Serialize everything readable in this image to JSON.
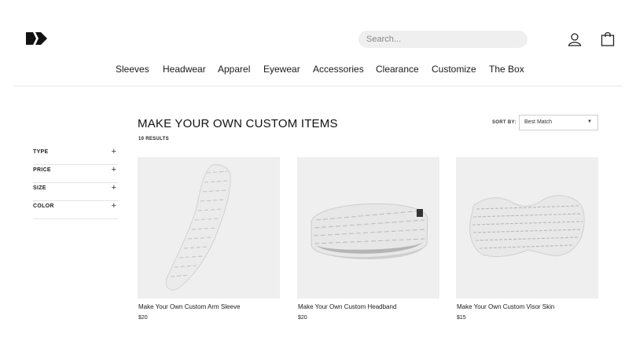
{
  "header": {
    "search_placeholder": "Search...",
    "user_icon": "user-icon",
    "cart_icon": "shopping-bag-icon"
  },
  "nav": {
    "items": [
      {
        "label": "Sleeves"
      },
      {
        "label": "Headwear"
      },
      {
        "label": "Apparel"
      },
      {
        "label": "Eyewear"
      },
      {
        "label": "Accessories"
      },
      {
        "label": "Clearance"
      },
      {
        "label": "Customize"
      },
      {
        "label": "The Box"
      }
    ]
  },
  "filters": [
    {
      "label": "TYPE",
      "toggle": "+"
    },
    {
      "label": "PRICE",
      "toggle": "+"
    },
    {
      "label": "SIZE",
      "toggle": "+"
    },
    {
      "label": "COLOR",
      "toggle": "+"
    }
  ],
  "listing": {
    "title": "MAKE YOUR OWN CUSTOM ITEMS",
    "result_count": "10 RESULTS",
    "sort_label": "SORT BY:",
    "sort_value": "Best Match"
  },
  "products": [
    {
      "name": "Make Your Own Custom Arm Sleeve",
      "price": "$20"
    },
    {
      "name": "Make Your Own Custom Headband",
      "price": "$20"
    },
    {
      "name": "Make Your Own Custom Visor Skin",
      "price": "$15"
    }
  ],
  "colors": {
    "image_bg": "#efefef",
    "product_light": "#e9e9e9",
    "product_text": "#bdbdbd",
    "divider": "#e3e3e3"
  }
}
